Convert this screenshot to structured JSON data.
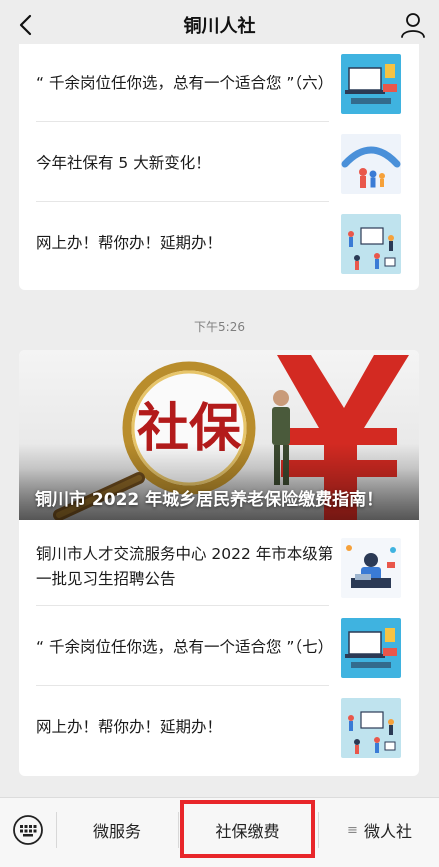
{
  "header": {
    "title": "铜川人社",
    "back_icon": "chevron-left-icon",
    "profile_icon": "person-icon"
  },
  "card1": {
    "items": [
      {
        "title": "“ 千余岗位任你选，总有一个适合您 ”（六）",
        "thumb": "laptop-office-illustration"
      },
      {
        "title": "今年社保有 5 大新变化！",
        "thumb": "hands-protecting-family"
      },
      {
        "title": "网上办！帮你办！延期办！",
        "thumb": "people-online-services-illustration"
      }
    ]
  },
  "timestamp": "下午5:26",
  "card2": {
    "banner": {
      "title": "铜川市 2022 年城乡居民养老保险缴费指南！",
      "magnifier_text": "社保"
    },
    "items": [
      {
        "title": "铜川市人才交流服务中心 2022 年市本级第一批见习生招聘公告",
        "thumb": "worker-desk-illustration"
      },
      {
        "title": "“ 千余岗位任你选，总有一个适合您 ”（七）",
        "thumb": "laptop-office-illustration"
      },
      {
        "title": "网上办！帮你办！延期办！",
        "thumb": "people-online-services-illustration"
      }
    ]
  },
  "bottom_bar": {
    "keyboard_icon": "keyboard-icon",
    "menu": [
      {
        "label": "微服务"
      },
      {
        "label": "社保缴费",
        "highlighted": true
      },
      {
        "label": "微人社",
        "has_submenu_glyph": "≡"
      }
    ],
    "highlight_color": "#e8262a"
  }
}
